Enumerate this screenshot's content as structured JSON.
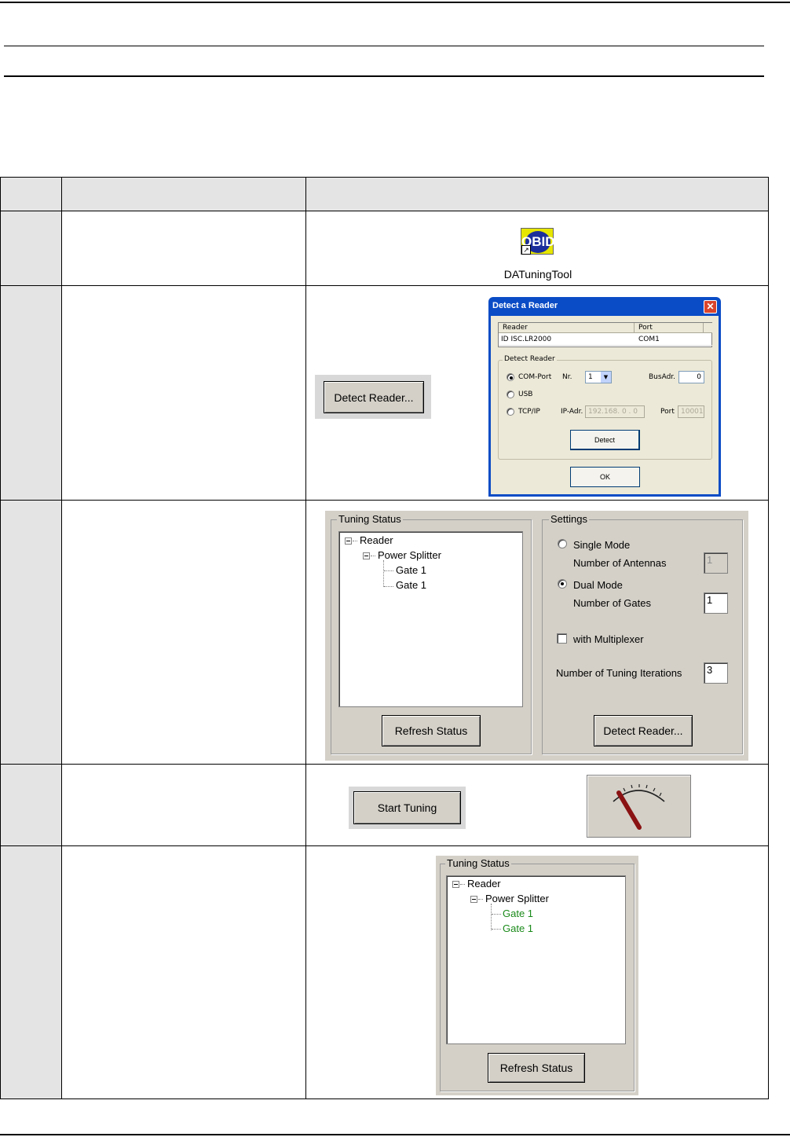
{
  "shortcut": {
    "icon_name": "obid-icon",
    "logo_text": "OBID",
    "label": "DATuningTool"
  },
  "detect_button": {
    "label": "Detect Reader..."
  },
  "detect_dialog": {
    "title": "Detect a Reader",
    "columns": [
      "Reader",
      "Port"
    ],
    "row": {
      "reader": "ID ISC.LR2000",
      "port": "COM1"
    },
    "group_label": "Detect Reader",
    "com_label": "COM-Port",
    "nr_label": "Nr.",
    "nr_value": "1",
    "busadr_label": "BusAdr.",
    "busadr_value": "0",
    "usb_label": "USB",
    "tcp_label": "TCP/IP",
    "ipadr_label": "IP-Adr.",
    "ipadr_value": "192.168. 0 . 0",
    "port_label": "Port",
    "port_value": "10001",
    "detect_label": "Detect",
    "ok_label": "OK"
  },
  "tuning_panel": {
    "status_label": "Tuning Status",
    "tree": {
      "root": "Reader",
      "child": "Power Splitter",
      "leaves": [
        "Gate 1",
        "Gate 1"
      ]
    },
    "refresh_label": "Refresh Status",
    "settings_label": "Settings",
    "single_mode": "Single Mode",
    "num_antennas_label": "Number of Antennas",
    "num_antennas_value": "1",
    "dual_mode": "Dual Mode",
    "num_gates_label": "Number of Gates",
    "num_gates_value": "1",
    "multiplexer_label": "with Multiplexer",
    "iterations_label": "Number of Tuning Iterations",
    "iterations_value": "3",
    "detect_label": "Detect Reader..."
  },
  "start_button": {
    "label": "Start Tuning"
  },
  "gauge": {
    "icon_name": "gauge-icon"
  },
  "result_panel": {
    "status_label": "Tuning Status",
    "tree": {
      "root": "Reader",
      "child": "Power Splitter",
      "leaves": [
        "Gate 1",
        "Gate 1"
      ]
    },
    "leaf_color": "#1a8a1a",
    "refresh_label": "Refresh Status"
  },
  "colors": {
    "dialog_face": "#d4d0c8",
    "xp_title_blue": "#0a4cc6",
    "close_red": "#d9442b",
    "table_grey": "#e4e4e4"
  }
}
